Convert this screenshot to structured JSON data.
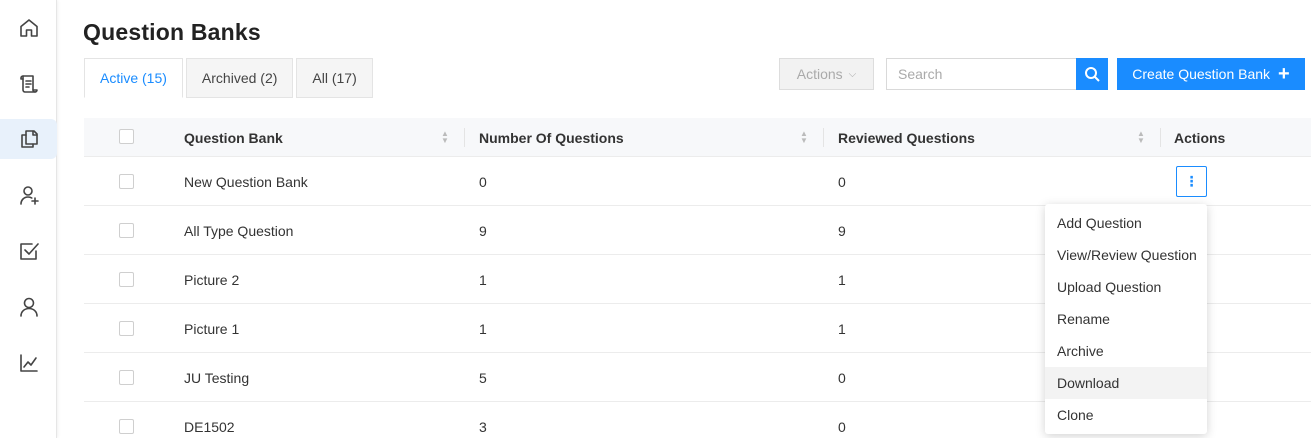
{
  "page": {
    "title": "Question Banks"
  },
  "sidebar": {
    "items": [
      {
        "icon": "home-icon"
      },
      {
        "icon": "scroll-icon"
      },
      {
        "icon": "copy-icon",
        "active": true
      },
      {
        "icon": "add-user-icon"
      },
      {
        "icon": "checkbox-icon"
      },
      {
        "icon": "user-icon"
      },
      {
        "icon": "chart-icon"
      }
    ]
  },
  "tabs": [
    {
      "label": "Active (15)",
      "active": true
    },
    {
      "label": "Archived (2)"
    },
    {
      "label": "All (17)"
    }
  ],
  "toolbar": {
    "actions_label": "Actions",
    "search_placeholder": "Search",
    "search_value": "",
    "create_label": "Create Question Bank"
  },
  "table": {
    "headers": [
      "Question Bank",
      "Number Of Questions",
      "Reviewed Questions",
      "Actions"
    ],
    "rows": [
      {
        "name": "New Question Bank",
        "questions": "0",
        "reviewed": "0"
      },
      {
        "name": "All Type Question",
        "questions": "9",
        "reviewed": "9"
      },
      {
        "name": "Picture 2",
        "questions": "1",
        "reviewed": "1"
      },
      {
        "name": "Picture 1",
        "questions": "1",
        "reviewed": "1"
      },
      {
        "name": "JU Testing",
        "questions": "5",
        "reviewed": "0"
      },
      {
        "name": "DE1502",
        "questions": "3",
        "reviewed": "0"
      }
    ]
  },
  "row_menu": {
    "items": [
      "Add Question",
      "View/Review Question",
      "Upload Question",
      "Rename",
      "Archive",
      "Download",
      "Clone"
    ],
    "hovered": "Download"
  },
  "colors": {
    "accent": "#1a8cff",
    "active_nav_bg": "#e8f1fb"
  }
}
